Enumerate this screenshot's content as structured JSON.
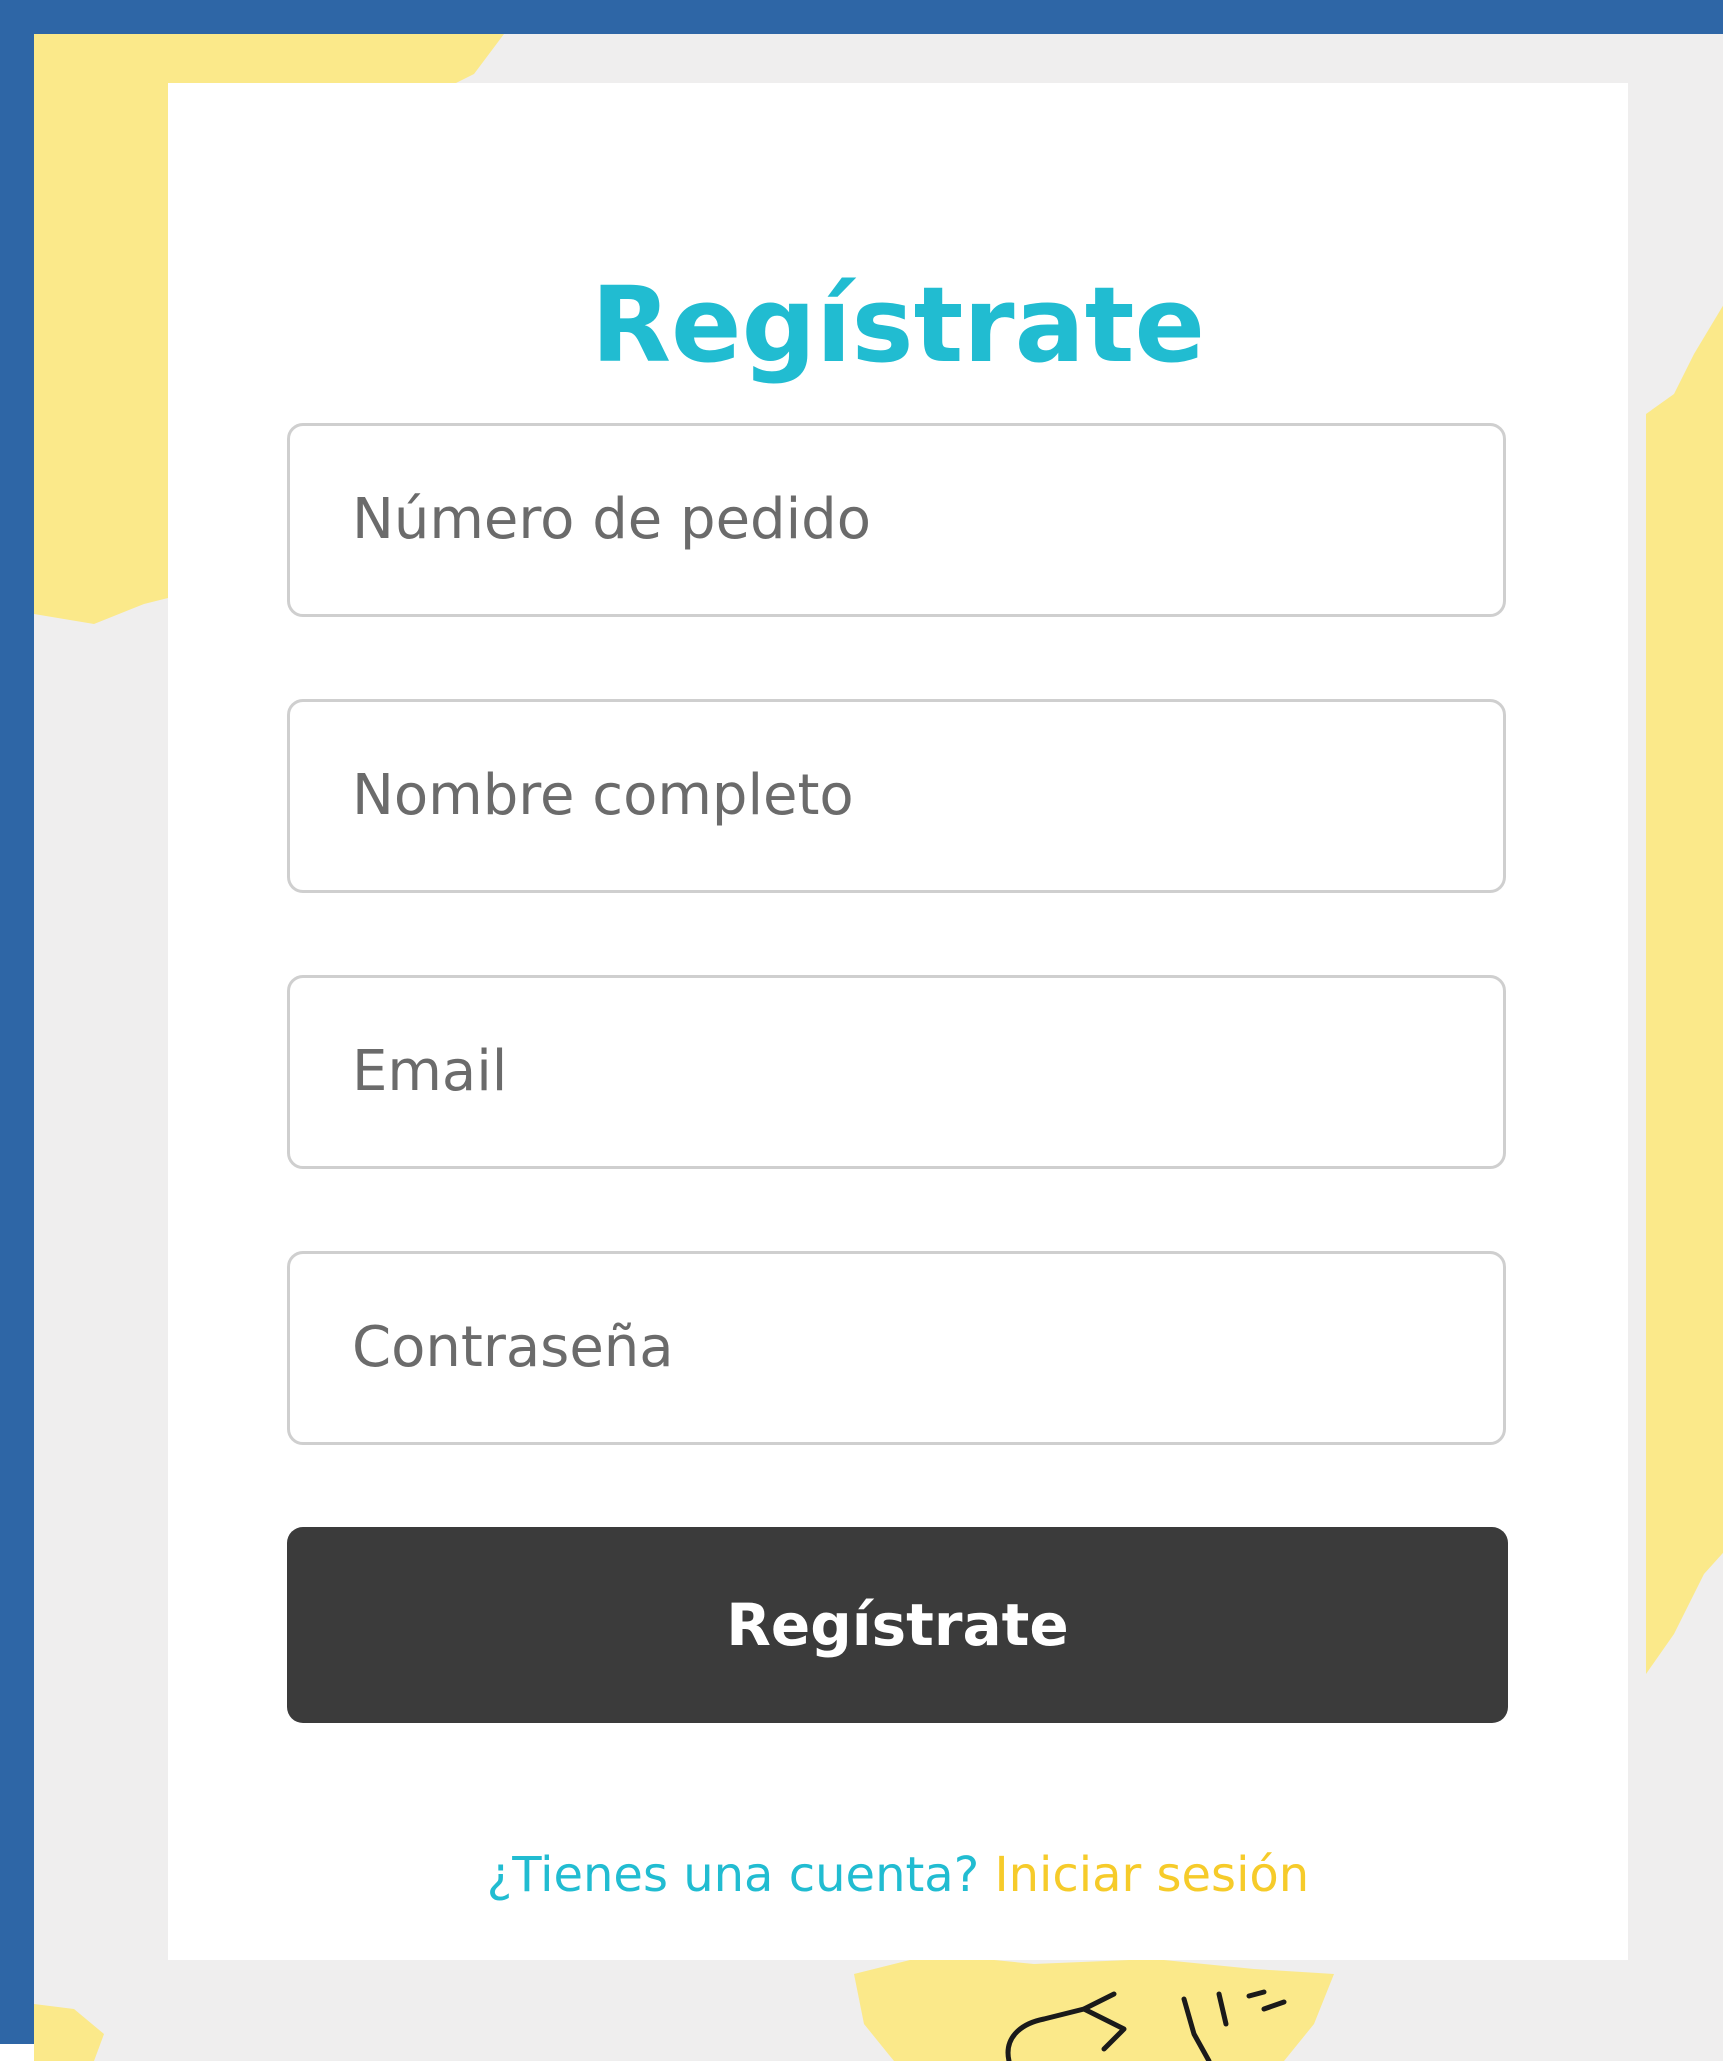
{
  "colors": {
    "frame": "#2e66a6",
    "map_background": "#efeeee",
    "map_land": "#fbe98a",
    "title": "#21bcd1",
    "button_background": "#3b3b3b",
    "link_accent": "#f6cb2a"
  },
  "form": {
    "title": "Regístrate",
    "fields": [
      {
        "placeholder": "Número de pedido"
      },
      {
        "placeholder": "Nombre completo"
      },
      {
        "placeholder": "Email"
      },
      {
        "placeholder": "Contraseña"
      }
    ],
    "submit_label": "Regístrate",
    "login_prompt": "¿Tienes una cuenta?",
    "login_link": "Iniciar sesión"
  },
  "background": {
    "icon": "paper-plane-sketch-icon"
  }
}
